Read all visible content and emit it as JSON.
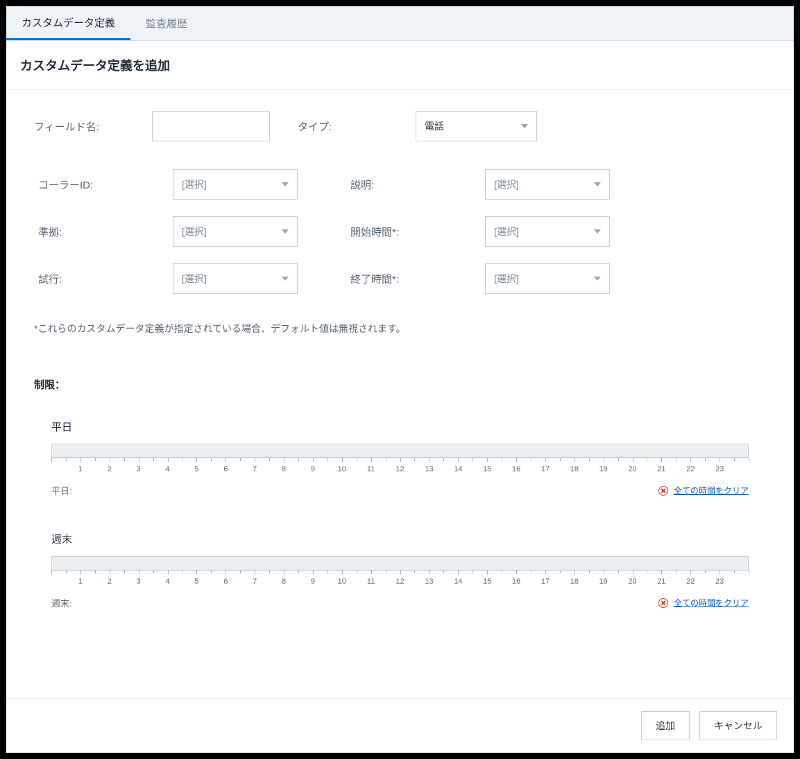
{
  "tabs": {
    "custom_data": "カスタムデータ定義",
    "audit_history": "監査履歴"
  },
  "page_title": "カスタムデータ定義を追加",
  "form": {
    "field_name_label": "フィールド名:",
    "field_name_value": "",
    "type_label": "タイプ:",
    "type_value": "電話",
    "select_placeholder": "[選択]",
    "caller_id_label": "コーラーID:",
    "description_label": "説明:",
    "compliance_label": "準拠:",
    "start_time_label": "開始時間*:",
    "attempts_label": "試行:",
    "end_time_label": "終了時間*:"
  },
  "note": "*これらのカスタムデータ定義が指定されている場合、デフォルト値は無視されます。",
  "restrictions": {
    "section_label": "制限：",
    "weekday_title": "平日",
    "weekday_footer_label": "平日:",
    "weekend_title": "週末",
    "weekend_footer_label": "週末:",
    "clear_all_label": "全ての時間をクリア",
    "hours": [
      "1",
      "2",
      "3",
      "4",
      "5",
      "6",
      "7",
      "8",
      "9",
      "10",
      "11",
      "12",
      "13",
      "14",
      "15",
      "16",
      "17",
      "18",
      "19",
      "20",
      "21",
      "22",
      "23"
    ]
  },
  "footer": {
    "add": "追加",
    "cancel": "キャンセル"
  }
}
